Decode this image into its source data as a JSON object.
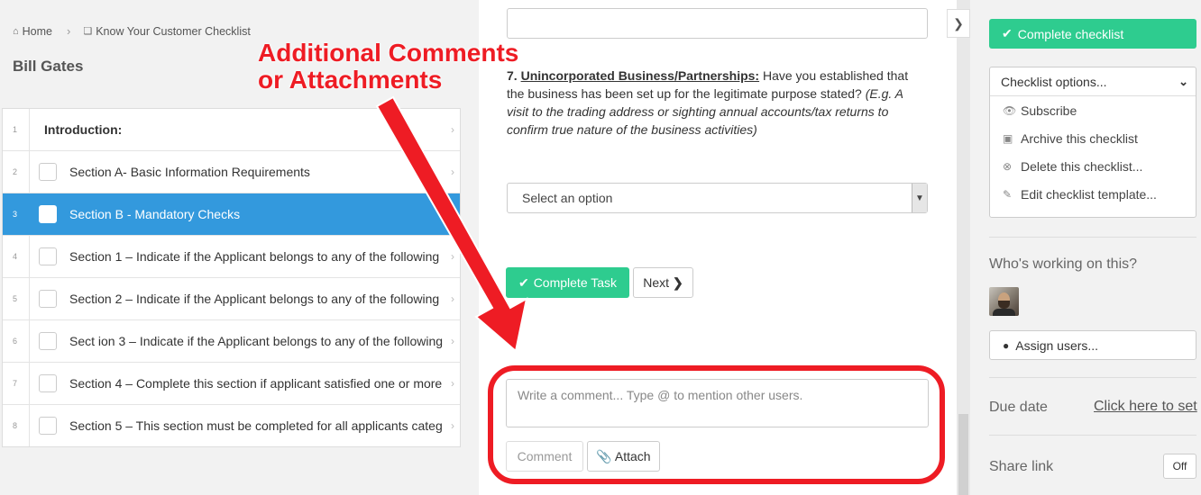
{
  "breadcrumb": {
    "home": "Home",
    "checklist": "Know Your Customer Checklist"
  },
  "title": "Bill Gates",
  "tasks": [
    {
      "num": "1",
      "label": "Introduction:"
    },
    {
      "num": "2",
      "label": "Section A- Basic Information Requirements"
    },
    {
      "num": "3",
      "label": "Section B - Mandatory Checks"
    },
    {
      "num": "4",
      "label": "Section 1 – Indicate if the Applicant belongs to any of the following"
    },
    {
      "num": "5",
      "label": "Section 2 – Indicate if the Applicant belongs to any of the following"
    },
    {
      "num": "6",
      "label": "Sect ion 3 – Indicate if the Applicant belongs to any of the following"
    },
    {
      "num": "7",
      "label": "Section 4 – Complete this section if applicant satisfied one or more"
    },
    {
      "num": "8",
      "label": "Section 5 – This section must be completed for all applicants categ"
    }
  ],
  "question": {
    "number": "7.",
    "heading": "Unincorporated Business/Partnerships:",
    "text": "Have you established that the business has been set up for the legitimate purpose stated?",
    "hint": "(E.g. A visit to the trading address or sighting annual accounts/tax returns to confirm true nature of the business activities)"
  },
  "select": {
    "value": "Select an option"
  },
  "actions": {
    "complete_task": "Complete Task",
    "next": "Next"
  },
  "comment": {
    "placeholder": "Write a comment... Type @ to mention other users.",
    "comment_button": "Comment",
    "attach_button": "Attach"
  },
  "annotation": {
    "line1": "Additional Comments",
    "line2": "or Attachments",
    "color": "#ee1c24"
  },
  "sidebar": {
    "complete_checklist": "Complete checklist",
    "options_label": "Checklist options...",
    "options": [
      {
        "icon": "eye-icon",
        "label": "Subscribe"
      },
      {
        "icon": "archive-icon",
        "label": "Archive this checklist"
      },
      {
        "icon": "delete-icon",
        "label": "Delete this checklist..."
      },
      {
        "icon": "pencil-icon",
        "label": "Edit checklist template..."
      }
    ],
    "working_label": "Who's working on this?",
    "assign_users": "Assign users...",
    "due_label": "Due date",
    "due_link": "Click here to set",
    "share_label": "Share link",
    "share_toggle": "Off"
  },
  "colors": {
    "accent_green": "#2ecc8f",
    "active_blue": "#3399dd",
    "annotation_red": "#ee1c24"
  }
}
